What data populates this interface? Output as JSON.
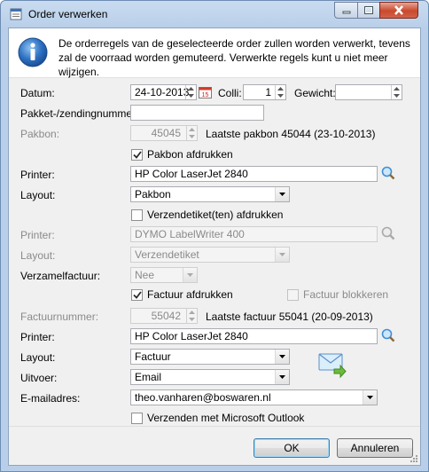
{
  "window": {
    "title": "Order verwerken",
    "colors": {
      "titlebar": "#b9cfe9",
      "close_button": "#c9492c",
      "info_icon": "#1f5fa8",
      "search_icon": "#3f8fd6"
    }
  },
  "info": {
    "text": "De orderregels van de geselecteerde order zullen worden verwerkt, tevens zal de voorraad worden gemuteerd. Verwerkte regels kunt u niet meer wijzigen."
  },
  "form": {
    "datum": {
      "label": "Datum:",
      "value": "24-10-2013",
      "calendar_day": "15"
    },
    "colli": {
      "label": "Colli:",
      "value": "1"
    },
    "gewicht": {
      "label": "Gewicht:",
      "value": ""
    },
    "pakket": {
      "label": "Pakket-/zendingnummer:",
      "value": ""
    },
    "pakbon": {
      "label": "Pakbon:",
      "value": "45045",
      "last_text": "Laatste pakbon 45044 (23-10-2013)"
    },
    "pakbon_print": {
      "label": "Pakbon afdrukken",
      "checked": true
    },
    "pakbon_printer": {
      "label": "Printer:",
      "value": "HP Color LaserJet 2840"
    },
    "pakbon_layout": {
      "label": "Layout:",
      "value": "Pakbon"
    },
    "etiket_print": {
      "label": "Verzendetiket(ten) afdrukken",
      "checked": false
    },
    "etiket_printer": {
      "label": "Printer:",
      "value": "DYMO LabelWriter 400"
    },
    "etiket_layout": {
      "label": "Layout:",
      "value": "Verzendetiket"
    },
    "verzamelfactuur": {
      "label": "Verzamelfactuur:",
      "value": "Nee"
    },
    "factuur_print": {
      "label": "Factuur afdrukken",
      "checked": true
    },
    "factuur_block": {
      "label": "Factuur blokkeren",
      "checked": false
    },
    "factuurnummer": {
      "label": "Factuurnummer:",
      "value": "55042",
      "last_text": "Laatste factuur 55041 (20-09-2013)"
    },
    "factuur_printer": {
      "label": "Printer:",
      "value": "HP Color LaserJet 2840"
    },
    "factuur_layout": {
      "label": "Layout:",
      "value": "Factuur"
    },
    "uitvoer": {
      "label": "Uitvoer:",
      "value": "Email"
    },
    "email": {
      "label": "E-mailadres:",
      "value": "theo.vanharen@boswaren.nl"
    },
    "outlook": {
      "label": "Verzenden met Microsoft Outlook",
      "checked": false
    }
  },
  "buttons": {
    "ok": "OK",
    "cancel": "Annuleren"
  }
}
